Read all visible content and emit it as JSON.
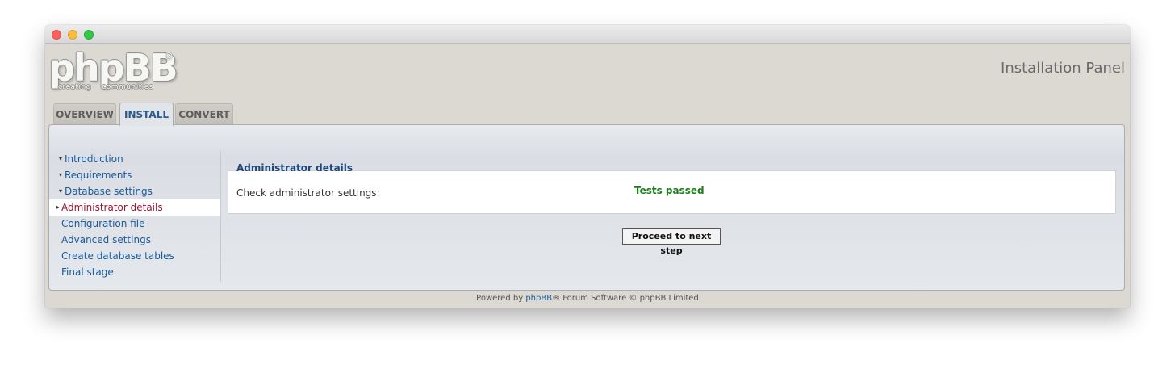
{
  "window": {
    "controls": [
      "close",
      "minimize",
      "maximize"
    ]
  },
  "header": {
    "logo": {
      "main": "phpBB",
      "registered": "®",
      "tagline": "creating communities"
    },
    "panel_title": "Installation Panel"
  },
  "tabs": [
    {
      "label": "OVERVIEW",
      "active": false
    },
    {
      "label": "INSTALL",
      "active": true
    },
    {
      "label": "CONVERT",
      "active": false
    }
  ],
  "menu": {
    "items": [
      {
        "label": "Introduction",
        "state": "done"
      },
      {
        "label": "Requirements",
        "state": "done"
      },
      {
        "label": "Database settings",
        "state": "done"
      },
      {
        "label": "Administrator details",
        "state": "active"
      },
      {
        "label": "Configuration file",
        "state": "pending"
      },
      {
        "label": "Advanced settings",
        "state": "pending"
      },
      {
        "label": "Create database tables",
        "state": "pending"
      },
      {
        "label": "Final stage",
        "state": "pending"
      }
    ]
  },
  "main": {
    "section_title": "Administrator details",
    "check_label": "Check administrator settings:",
    "check_result": "Tests passed",
    "proceed_button": "Proceed to next step"
  },
  "footer": {
    "prefix": "Powered by ",
    "link": "phpBB",
    "suffix": "® Forum Software © phpBB Limited"
  },
  "colors": {
    "link": "#1a5a9a",
    "active_item": "#9e1232",
    "success": "#1b7d1b",
    "chrome_bg": "#dcd9d2"
  }
}
